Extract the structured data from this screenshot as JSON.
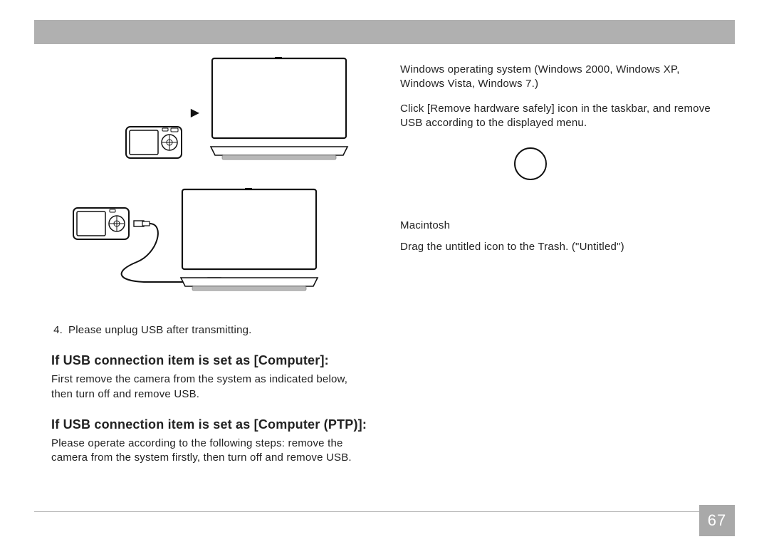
{
  "left": {
    "step4_num": "4.",
    "step4_text": "Please unplug USB after transmitting.",
    "sect1_heading": "If USB connection item is set as [Computer]:",
    "sect1_body": "First remove the camera from the system as indicated below, then turn off and remove USB.",
    "sect2_heading": "If USB connection item is set as [Computer (PTP)]:",
    "sect2_body": "Please operate according to the following steps: remove the camera from the system firstly, then turn off and remove USB."
  },
  "right": {
    "win_para1": "Windows operating system (Windows 2000, Windows XP, Windows Vista, Windows 7.)",
    "win_para2": "Click [Remove hardware safely] icon in the taskbar, and remove USB according to the displayed menu.",
    "mac_heading": "Macintosh",
    "mac_body": "Drag the untitled icon to the Trash. (\"Untitled\")"
  },
  "page_number": "67"
}
